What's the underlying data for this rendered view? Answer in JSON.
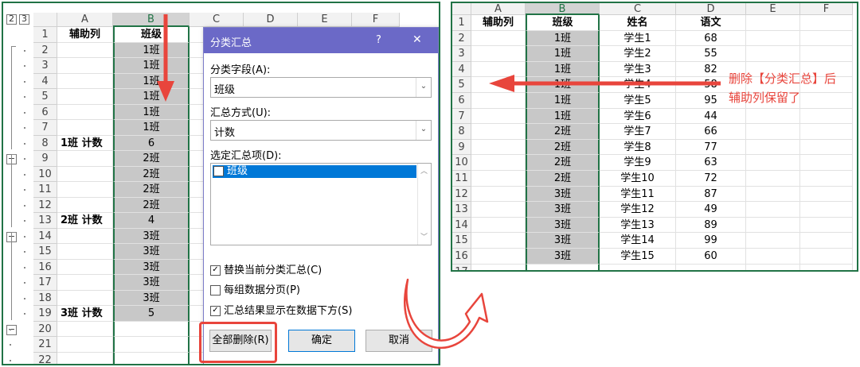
{
  "left": {
    "outline_levels": [
      "2",
      "3"
    ],
    "columns": [
      "A",
      "B",
      "C",
      "D",
      "E",
      "F"
    ],
    "rows": [
      {
        "n": "1",
        "a": "辅助列",
        "b": "班级"
      },
      {
        "n": "2",
        "a": "",
        "b": "1班"
      },
      {
        "n": "3",
        "a": "",
        "b": "1班"
      },
      {
        "n": "4",
        "a": "",
        "b": "1班"
      },
      {
        "n": "5",
        "a": "",
        "b": "1班"
      },
      {
        "n": "6",
        "a": "",
        "b": "1班"
      },
      {
        "n": "7",
        "a": "",
        "b": "1班"
      },
      {
        "n": "8",
        "a": "1班 计数",
        "b": "6"
      },
      {
        "n": "9",
        "a": "",
        "b": "2班"
      },
      {
        "n": "10",
        "a": "",
        "b": "2班"
      },
      {
        "n": "11",
        "a": "",
        "b": "2班"
      },
      {
        "n": "12",
        "a": "",
        "b": "2班"
      },
      {
        "n": "13",
        "a": "2班 计数",
        "b": "4"
      },
      {
        "n": "14",
        "a": "",
        "b": "3班"
      },
      {
        "n": "15",
        "a": "",
        "b": "3班"
      },
      {
        "n": "16",
        "a": "",
        "b": "3班"
      },
      {
        "n": "17",
        "a": "",
        "b": "3班"
      },
      {
        "n": "18",
        "a": "",
        "b": "3班"
      },
      {
        "n": "19",
        "a": "3班 计数",
        "b": "5"
      },
      {
        "n": "20",
        "a": "",
        "b": ""
      },
      {
        "n": "21",
        "a": "",
        "b": ""
      },
      {
        "n": "22",
        "a": "",
        "b": ""
      }
    ]
  },
  "dialog": {
    "title": "分类汇总",
    "help": "?",
    "close": "✕",
    "field_label": "分类字段(A):",
    "field_value": "班级",
    "method_label": "汇总方式(U):",
    "method_value": "计数",
    "items_label": "选定汇总项(D):",
    "items": [
      {
        "label": "班级",
        "checked": true
      }
    ],
    "opt_replace": "替换当前分类汇总(C)",
    "opt_pagebreak": "每组数据分页(P)",
    "opt_below": "汇总结果显示在数据下方(S)",
    "opt_replace_checked": true,
    "opt_pagebreak_checked": false,
    "opt_below_checked": true,
    "btn_remove_all": "全部删除(R)",
    "btn_ok": "确定",
    "btn_cancel": "取消"
  },
  "right": {
    "columns": [
      "A",
      "B",
      "C",
      "D",
      "E",
      "F"
    ],
    "rows": [
      {
        "n": "1",
        "a": "辅助列",
        "b": "班级",
        "c": "姓名",
        "d": "语文"
      },
      {
        "n": "2",
        "a": "",
        "b": "1班",
        "c": "学生1",
        "d": "68"
      },
      {
        "n": "3",
        "a": "",
        "b": "1班",
        "c": "学生2",
        "d": "55"
      },
      {
        "n": "4",
        "a": "",
        "b": "1班",
        "c": "学生3",
        "d": "82"
      },
      {
        "n": "5",
        "a": "",
        "b": "1班",
        "c": "学生4",
        "d": "58"
      },
      {
        "n": "6",
        "a": "",
        "b": "1班",
        "c": "学生5",
        "d": "95"
      },
      {
        "n": "7",
        "a": "",
        "b": "1班",
        "c": "学生6",
        "d": "44"
      },
      {
        "n": "8",
        "a": "",
        "b": "2班",
        "c": "学生7",
        "d": "66"
      },
      {
        "n": "9",
        "a": "",
        "b": "2班",
        "c": "学生8",
        "d": "77"
      },
      {
        "n": "10",
        "a": "",
        "b": "2班",
        "c": "学生9",
        "d": "63"
      },
      {
        "n": "11",
        "a": "",
        "b": "2班",
        "c": "学生10",
        "d": "72"
      },
      {
        "n": "12",
        "a": "",
        "b": "3班",
        "c": "学生11",
        "d": "87"
      },
      {
        "n": "13",
        "a": "",
        "b": "3班",
        "c": "学生12",
        "d": "49"
      },
      {
        "n": "14",
        "a": "",
        "b": "3班",
        "c": "学生13",
        "d": "89"
      },
      {
        "n": "15",
        "a": "",
        "b": "3班",
        "c": "学生14",
        "d": "99"
      },
      {
        "n": "16",
        "a": "",
        "b": "3班",
        "c": "学生15",
        "d": "60"
      },
      {
        "n": "17",
        "a": "",
        "b": "",
        "c": "",
        "d": ""
      }
    ]
  },
  "annotation": {
    "line1": "删除【分类汇总】后",
    "line2": "辅助列保留了"
  },
  "colors": {
    "excel_green": "#217346",
    "dialog_title": "#6b69c7",
    "annotation_red": "#e8453c",
    "highlight_red": "#e8453c"
  }
}
